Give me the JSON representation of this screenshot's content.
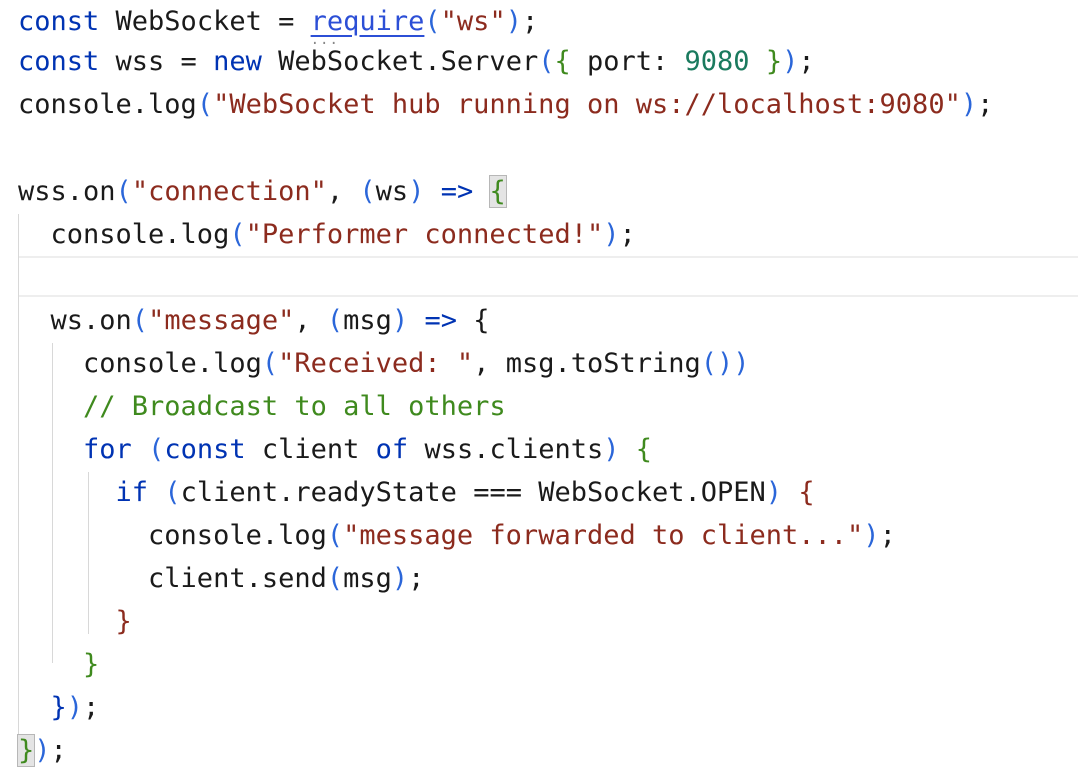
{
  "editor": {
    "lines": [
      {
        "tokens": [
          {
            "t": "const",
            "c": "kw"
          },
          {
            "t": " WebSocket = ",
            "c": ""
          },
          {
            "t": "require",
            "c": "link"
          },
          {
            "t": "(",
            "c": "paren"
          },
          {
            "t": "\"ws\"",
            "c": "str"
          },
          {
            "t": ")",
            "c": "paren"
          },
          {
            "t": ";",
            "c": ""
          }
        ]
      },
      {
        "tokens": [
          {
            "t": "const",
            "c": "kw"
          },
          {
            "t": " wss = ",
            "c": ""
          },
          {
            "t": "new",
            "c": "kw"
          },
          {
            "t": " WebSocket.Server",
            "c": ""
          },
          {
            "t": "(",
            "c": "paren"
          },
          {
            "t": "{",
            "c": "brace"
          },
          {
            "t": " port: ",
            "c": ""
          },
          {
            "t": "9080",
            "c": "num"
          },
          {
            "t": " }",
            "c": "brace"
          },
          {
            "t": ")",
            "c": "paren"
          },
          {
            "t": ";",
            "c": ""
          }
        ]
      },
      {
        "tokens": [
          {
            "t": "console.log",
            "c": ""
          },
          {
            "t": "(",
            "c": "paren"
          },
          {
            "t": "\"WebSocket hub running on ws://localhost:9080\"",
            "c": "str"
          },
          {
            "t": ")",
            "c": "paren"
          },
          {
            "t": ";",
            "c": ""
          }
        ]
      },
      {
        "tokens": []
      },
      {
        "tokens": [
          {
            "t": "wss.on",
            "c": ""
          },
          {
            "t": "(",
            "c": "paren"
          },
          {
            "t": "\"connection\"",
            "c": "str"
          },
          {
            "t": ", ",
            "c": ""
          },
          {
            "t": "(",
            "c": "paren"
          },
          {
            "t": "ws",
            "c": ""
          },
          {
            "t": ")",
            "c": "paren"
          },
          {
            "t": " ",
            "c": ""
          },
          {
            "t": "=>",
            "c": "kw"
          },
          {
            "t": " ",
            "c": ""
          },
          {
            "t": "{",
            "c": "brace brace-hl"
          }
        ]
      },
      {
        "tokens": [
          {
            "t": "  console.log",
            "c": ""
          },
          {
            "t": "(",
            "c": "paren"
          },
          {
            "t": "\"Performer connected!\"",
            "c": "str"
          },
          {
            "t": ")",
            "c": "paren"
          },
          {
            "t": ";",
            "c": ""
          }
        ]
      },
      {
        "tokens": []
      },
      {
        "tokens": [
          {
            "t": "  ws.on",
            "c": ""
          },
          {
            "t": "(",
            "c": "paren"
          },
          {
            "t": "\"message\"",
            "c": "str"
          },
          {
            "t": ", ",
            "c": ""
          },
          {
            "t": "(",
            "c": "paren"
          },
          {
            "t": "msg",
            "c": ""
          },
          {
            "t": ")",
            "c": "paren"
          },
          {
            "t": " ",
            "c": ""
          },
          {
            "t": "=>",
            "c": "kw"
          },
          {
            "t": " {",
            "c": ""
          }
        ]
      },
      {
        "tokens": [
          {
            "t": "    console.log",
            "c": ""
          },
          {
            "t": "(",
            "c": "paren"
          },
          {
            "t": "\"Received: \"",
            "c": "str"
          },
          {
            "t": ", msg.toString",
            "c": ""
          },
          {
            "t": "()",
            "c": "paren"
          },
          {
            "t": ")",
            "c": "paren"
          }
        ]
      },
      {
        "tokens": [
          {
            "t": "    // Broadcast to all others",
            "c": "com"
          }
        ]
      },
      {
        "tokens": [
          {
            "t": "    ",
            "c": ""
          },
          {
            "t": "for",
            "c": "kw"
          },
          {
            "t": " ",
            "c": ""
          },
          {
            "t": "(",
            "c": "paren"
          },
          {
            "t": "const",
            "c": "kw"
          },
          {
            "t": " client ",
            "c": ""
          },
          {
            "t": "of",
            "c": "kw"
          },
          {
            "t": " wss.clients",
            "c": ""
          },
          {
            "t": ")",
            "c": "paren"
          },
          {
            "t": " {",
            "c": "brace"
          }
        ]
      },
      {
        "tokens": [
          {
            "t": "      ",
            "c": ""
          },
          {
            "t": "if",
            "c": "kw"
          },
          {
            "t": " ",
            "c": ""
          },
          {
            "t": "(",
            "c": "paren"
          },
          {
            "t": "client.readyState === WebSocket.OPEN",
            "c": ""
          },
          {
            "t": ")",
            "c": "paren"
          },
          {
            "t": " {",
            "c": "str"
          }
        ]
      },
      {
        "tokens": [
          {
            "t": "        console.log",
            "c": ""
          },
          {
            "t": "(",
            "c": "paren"
          },
          {
            "t": "\"message forwarded to client...\"",
            "c": "str"
          },
          {
            "t": ")",
            "c": "paren"
          },
          {
            "t": ";",
            "c": ""
          }
        ]
      },
      {
        "tokens": [
          {
            "t": "        client.send",
            "c": ""
          },
          {
            "t": "(",
            "c": "paren"
          },
          {
            "t": "msg",
            "c": ""
          },
          {
            "t": ")",
            "c": "paren"
          },
          {
            "t": ";",
            "c": ""
          }
        ]
      },
      {
        "tokens": [
          {
            "t": "      }",
            "c": "str"
          }
        ]
      },
      {
        "tokens": [
          {
            "t": "    }",
            "c": "brace"
          }
        ]
      },
      {
        "tokens": [
          {
            "t": "  }",
            "c": "kw"
          },
          {
            "t": ")",
            "c": "paren"
          },
          {
            "t": ";",
            "c": ""
          }
        ]
      },
      {
        "tokens": [
          {
            "t": "}",
            "c": "brace brace-hl"
          },
          {
            "t": ")",
            "c": "paren"
          },
          {
            "t": ";",
            "c": ""
          }
        ]
      }
    ],
    "colors": {
      "keyword": "#0033b3",
      "string": "#8c2b1e",
      "number": "#1a7a5e",
      "comment": "#3f8a1e",
      "paren": "#2b66d9",
      "brace": "#3f8a1e"
    }
  }
}
